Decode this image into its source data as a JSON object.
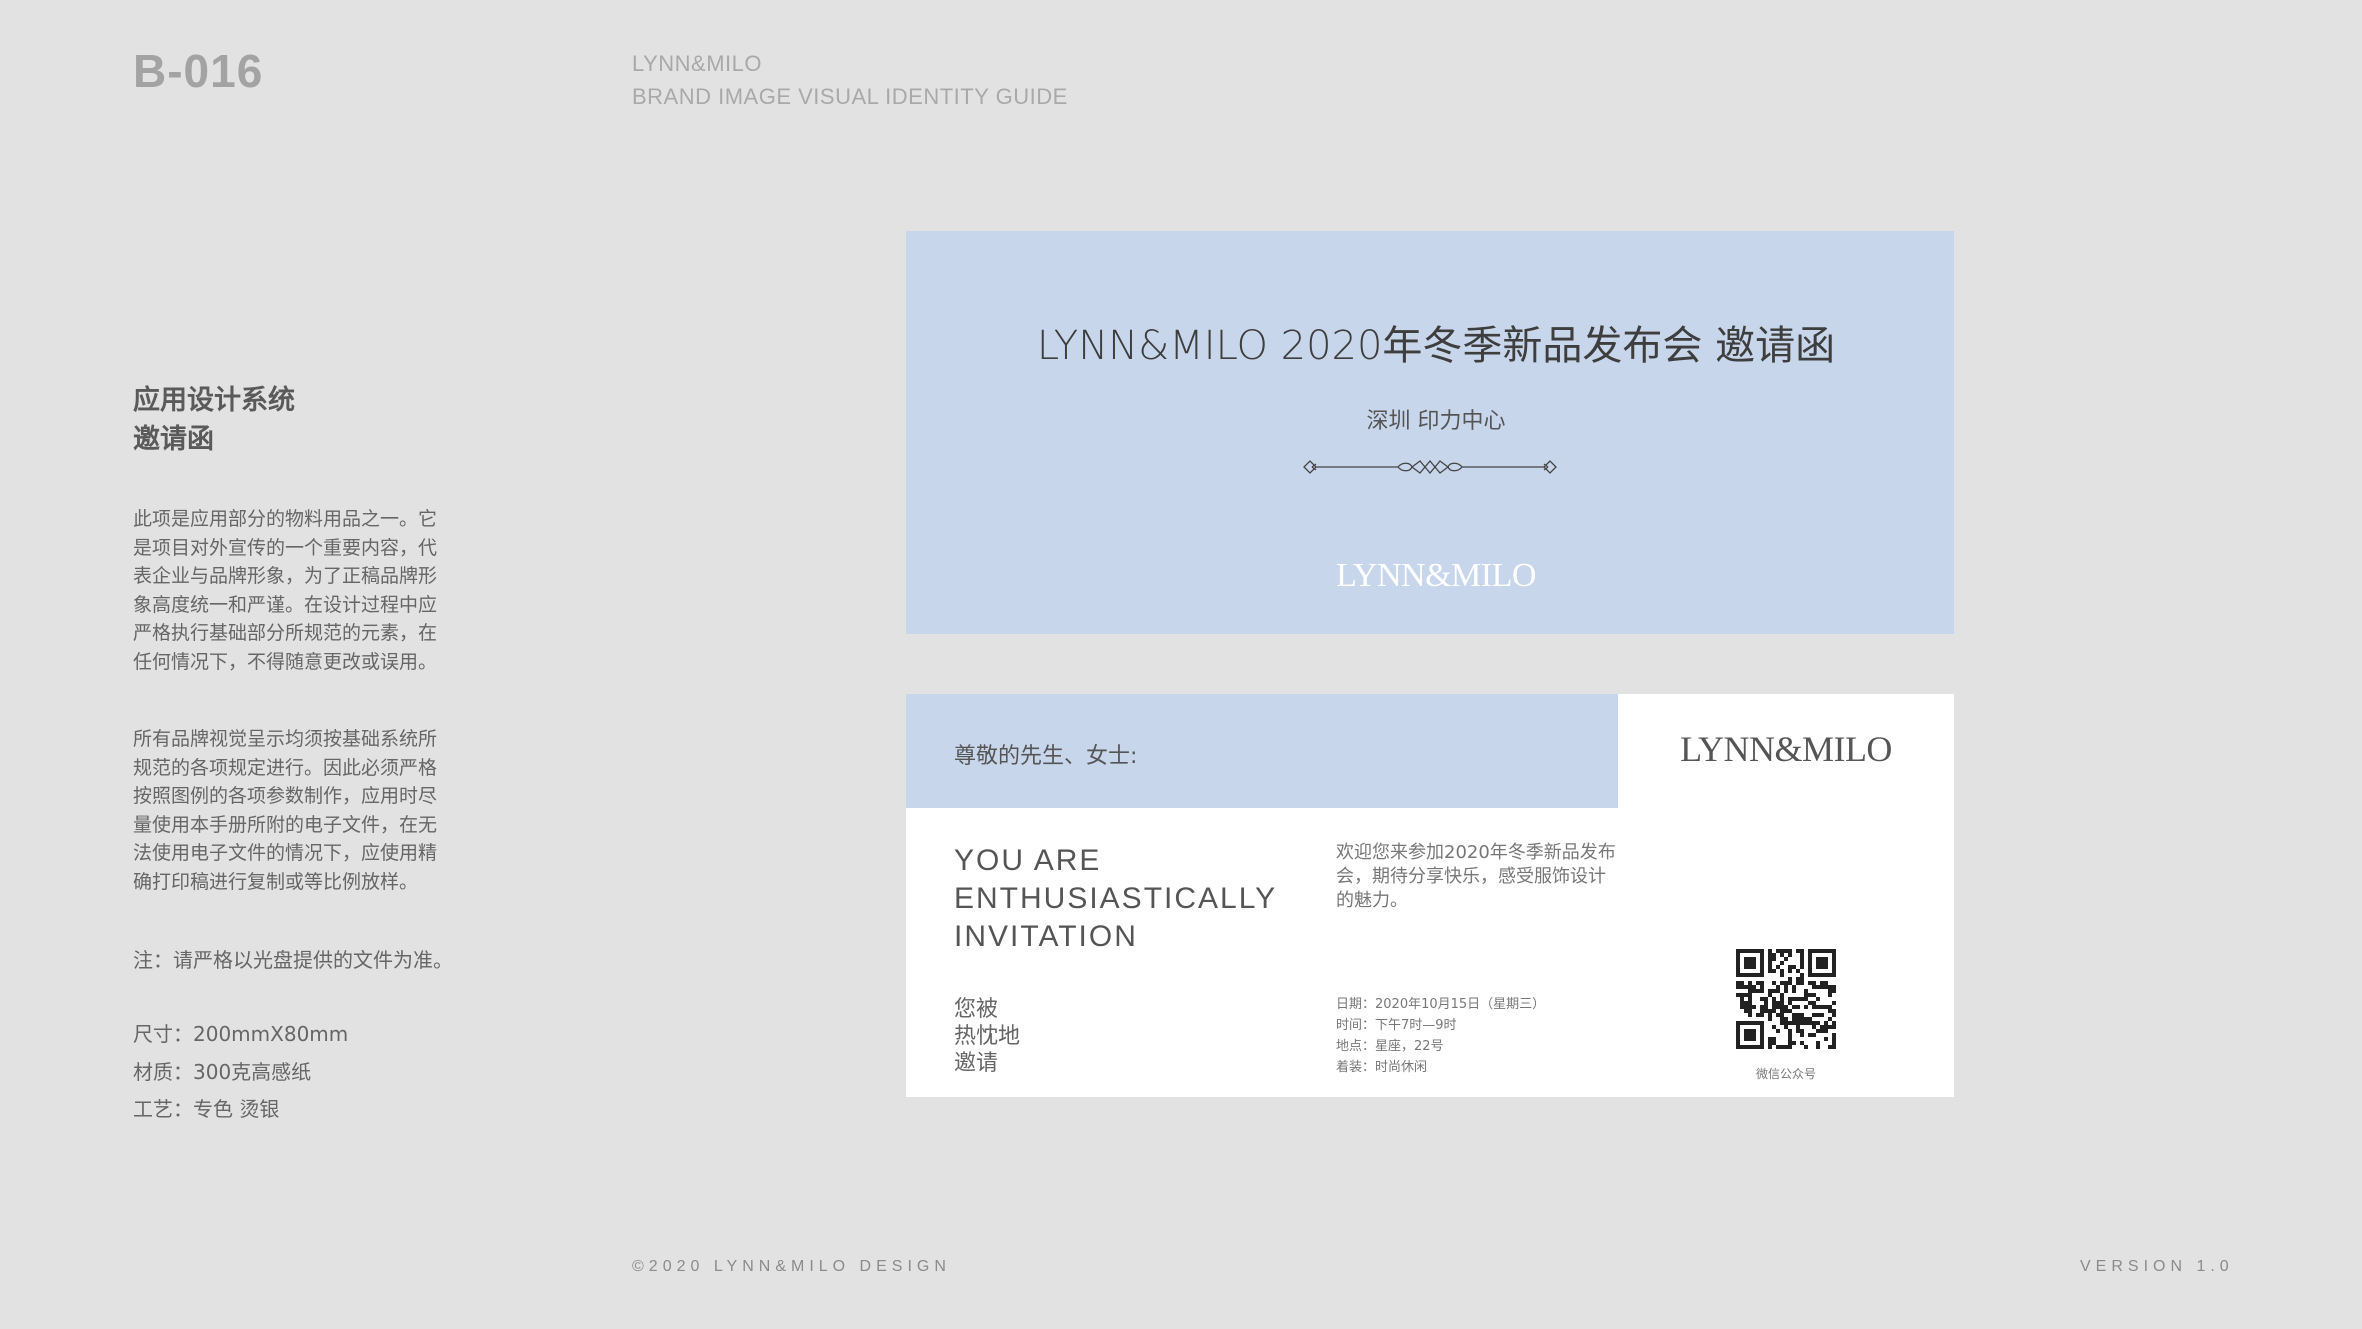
{
  "header": {
    "page_code": "B-016",
    "brand": "LYNN&MILO",
    "guide_title": "BRAND IMAGE VISUAL IDENTITY GUIDE"
  },
  "sidebar": {
    "title_line1": "应用设计系统",
    "title_line2": "邀请函",
    "para1_lines": [
      "此项是应用部分的物料用品之一。它",
      "是项目对外宣传的一个重要内容，代",
      "表企业与品牌形象，为了正稿品牌形",
      "象高度统一和严谨。在设计过程中应",
      "严格执行基础部分所规范的元素，在",
      "任何情况下，不得随意更改或误用。"
    ],
    "para2_lines": [
      "所有品牌视觉呈示均须按基础系统所",
      "规范的各项规定进行。因此必须严格",
      "按照图例的各项参数制作，应用时尽",
      "量使用本手册所附的电子文件，在无",
      "法使用电子文件的情况下，应使用精",
      "确打印稿进行复制或等比例放样。"
    ],
    "note": "注：请严格以光盘提供的文件为准。",
    "spec_size": "尺寸：200mmX80mm",
    "spec_material": "材质：300克高感纸",
    "spec_craft": "工艺：专色  烫银"
  },
  "invitation_front": {
    "title": "LYNN&MILO 2020年冬季新品发布会  邀请函",
    "venue": "深圳  印力中心",
    "logo": "LYNN&MILO"
  },
  "invitation_back": {
    "greeting": "尊敬的先生、女士:",
    "logo": "LYNN&MILO",
    "headline_lines": [
      "YOU ARE",
      "ENTHUSIASTICALLY",
      "INVITATION"
    ],
    "invite_cn_lines": [
      "您被",
      "热忱地",
      "邀请"
    ],
    "welcome_lines": [
      "欢迎您来参加2020年冬季新品发布",
      "会，期待分享快乐，感受服饰设计",
      "的魅力。"
    ],
    "details": [
      "日期：2020年10月15日（星期三）",
      "时间：下午7时—9时",
      "地点：星座，22号",
      "着装：时尚休闲"
    ],
    "qr_caption": "微信公众号"
  },
  "footer": {
    "copyright": "©2020 LYNN&MILO DESIGN",
    "version": "VERSION 1.0"
  },
  "colors": {
    "background": "#e2e2e2",
    "card_blue": "#c8d6eb",
    "white": "#ffffff"
  }
}
